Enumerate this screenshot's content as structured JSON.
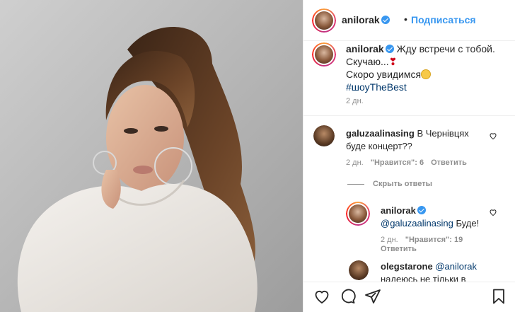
{
  "post": {
    "username": "anilorak",
    "follow_label": "Подписаться",
    "separator": "•",
    "caption_line1": "Жду встречи с тобой.",
    "caption_line2": "Скучаю...",
    "caption_line3": "Скоро увидимся",
    "hashtag": "#шоуTheBest",
    "time": "2 дн."
  },
  "comments": [
    {
      "username": "galuzaalinasing",
      "text_line1": "В Чернівцях",
      "text_line2": "буде концерт??",
      "time": "2 дн.",
      "likes": "\"Нравится\": 6",
      "reply_label": "Ответить"
    }
  ],
  "hide_replies_label": "Скрыть ответы",
  "reply": {
    "username": "anilorak",
    "mention": "@galuzaalinasing",
    "text": " Буде!",
    "time": "2 дн.",
    "likes": "\"Нравится\": 19",
    "reply_label": "Ответить"
  },
  "reply2": {
    "username": "olegstarone",
    "mention": "@anilorak",
    "text_partial": "надеюсь не тільки в"
  },
  "icons": {
    "like": "heart-icon",
    "comment": "comment-icon",
    "share": "paper-plane-icon",
    "save": "bookmark-icon"
  },
  "colors": {
    "link": "#3897f0",
    "hashtag": "#00376b",
    "muted": "#8e8e8e",
    "verified": "#3897f0"
  }
}
